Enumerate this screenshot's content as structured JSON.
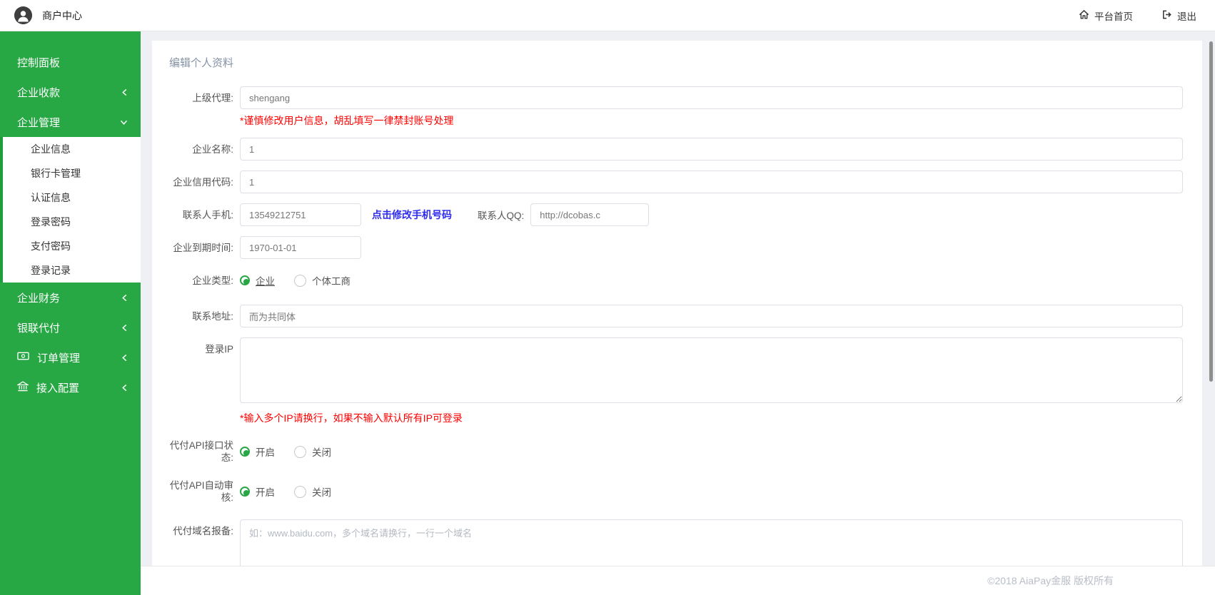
{
  "colors": {
    "accent_green": "#28a745",
    "warning_red": "#ff0000",
    "link_blue": "#2f2bf0",
    "title_color": "#8492a6"
  },
  "topbar": {
    "brand": "商户中心",
    "home_label": "平台首页",
    "logout_label": "退出"
  },
  "sidebar": {
    "items": [
      {
        "label": "控制面板"
      },
      {
        "label": "企业收款",
        "chevron": "collapsed"
      },
      {
        "label": "企业管理",
        "chevron": "expanded",
        "children": [
          "企业信息",
          "银行卡管理",
          "认证信息",
          "登录密码",
          "支付密码",
          "登录记录"
        ]
      },
      {
        "label": "企业财务",
        "chevron": "collapsed"
      },
      {
        "label": "银联代付",
        "chevron": "collapsed"
      },
      {
        "label": "订单管理",
        "icon": "banknote-icon",
        "chevron": "collapsed"
      },
      {
        "label": "接入配置",
        "icon": "bank-icon",
        "chevron": "collapsed"
      }
    ]
  },
  "page": {
    "title": "编辑个人资料"
  },
  "form": {
    "parent_agent": {
      "label": "上级代理:",
      "value": "shengang",
      "note": "*谨慎修改用户信息，胡乱填写一律禁封账号处理"
    },
    "company_name": {
      "label": "企业名称:",
      "value": "1"
    },
    "credit_code": {
      "label": "企业信用代码:",
      "value": "1"
    },
    "contact_phone": {
      "label": "联系人手机:",
      "value": "13549212751",
      "link": "点击修改手机号码"
    },
    "contact_qq": {
      "label": "联系人QQ:",
      "value": "http://dcobas.c"
    },
    "expire_date": {
      "label": "企业到期时间:",
      "value": "1970-01-01"
    },
    "company_type": {
      "label": "企业类型:",
      "options": [
        "企业",
        "个体工商"
      ],
      "selected": "企业"
    },
    "contact_address": {
      "label": "联系地址:",
      "value": "而为共同体"
    },
    "login_ip": {
      "label": "登录IP",
      "value": "",
      "note": "*输入多个IP请换行，如果不输入默认所有IP可登录"
    },
    "api_status": {
      "label": "代付API接口状态:",
      "options": [
        "开启",
        "关闭"
      ],
      "selected": "开启"
    },
    "api_auto_audit": {
      "label": "代付API自动审核:",
      "options": [
        "开启",
        "关闭"
      ],
      "selected": "开启"
    },
    "domain_report": {
      "label": "代付域名报备:",
      "placeholder": "如：www.baidu.com，多个域名请换行，一行一个域名"
    }
  },
  "footer": {
    "copyright": "©2018 AiaPay金服 版权所有"
  }
}
